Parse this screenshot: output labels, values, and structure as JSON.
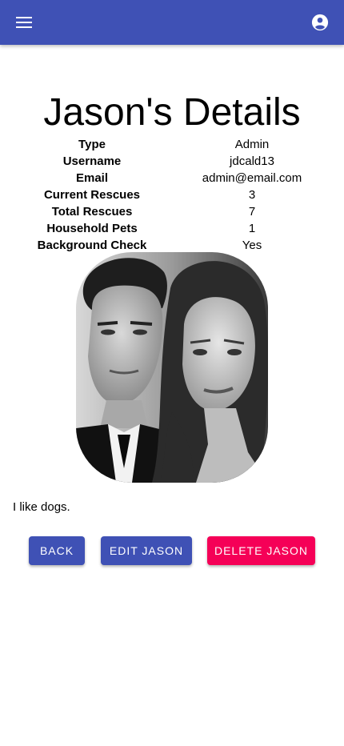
{
  "appbar": {
    "menu_icon": "menu-icon",
    "account_icon": "account-circle-icon",
    "color": "#3f51b5"
  },
  "page": {
    "title": "Jason's Details",
    "bio": "I like dogs."
  },
  "details": [
    {
      "label": "Type",
      "value": "Admin"
    },
    {
      "label": "Username",
      "value": "jdcald13"
    },
    {
      "label": "Email",
      "value": "admin@email.com"
    },
    {
      "label": "Current Rescues",
      "value": "3"
    },
    {
      "label": "Total Rescues",
      "value": "7"
    },
    {
      "label": "Household Pets",
      "value": "1"
    },
    {
      "label": "Background Check",
      "value": "Yes"
    }
  ],
  "actions": {
    "back_label": "BACK",
    "edit_label": "EDIT JASON",
    "delete_label": "DELETE JASON",
    "primary_color": "#3f51b5",
    "danger_color": "#f50057"
  }
}
